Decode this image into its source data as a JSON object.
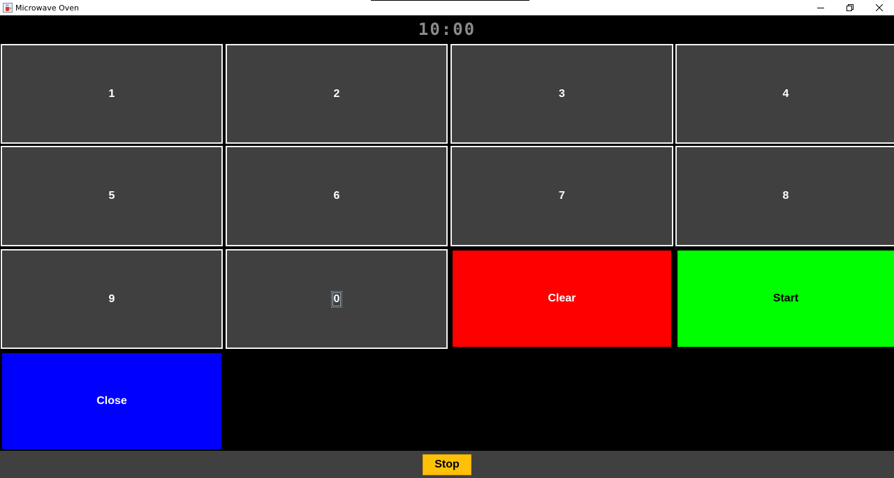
{
  "window": {
    "title": "Microwave Oven",
    "icon": "java-cup-icon",
    "controls": [
      "minimize-icon",
      "restore-icon",
      "close-icon"
    ]
  },
  "display": {
    "time": "10:00",
    "color": "#8a8a8a"
  },
  "keypad": {
    "digits": [
      "1",
      "2",
      "3",
      "4",
      "5",
      "6",
      "7",
      "8",
      "9",
      "0"
    ],
    "focused_digit": "0",
    "clear_label": "Clear",
    "start_label": "Start",
    "close_label": "Close"
  },
  "bottom": {
    "stop_label": "Stop"
  },
  "colors": {
    "key_bg": "#404040",
    "clear": "#ff0000",
    "start": "#00ff00",
    "close": "#0000ff",
    "stop": "#ffc107"
  }
}
